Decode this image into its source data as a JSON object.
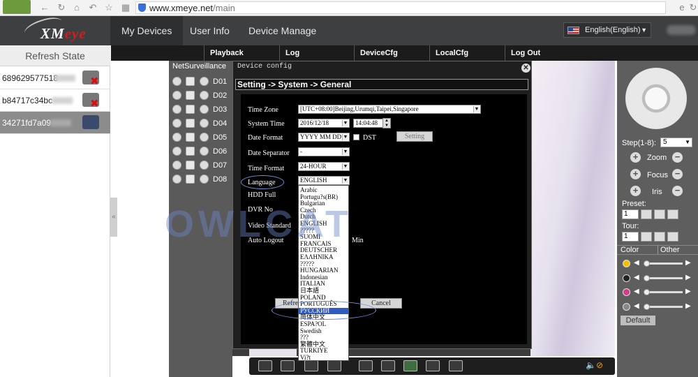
{
  "browser": {
    "url_host": "www.xmeye.net",
    "url_path": "/main"
  },
  "header": {
    "logo_prefix": "XM",
    "logo_suffix": "eye",
    "tabs": [
      "My Devices",
      "User Info",
      "Device Manage"
    ],
    "language": "English(English)"
  },
  "sidebar": {
    "refresh_label": "Refresh State",
    "devices": [
      "689629577518",
      "b84717c34bc",
      "34271fd7a09"
    ]
  },
  "toolbar": [
    "Playback",
    "Log",
    "DeviceCfg",
    "LocalCfg",
    "Log Out"
  ],
  "channels": {
    "title": "NetSurveillance",
    "items": [
      "D01",
      "D02",
      "D03",
      "D04",
      "D05",
      "D06",
      "D07",
      "D08"
    ]
  },
  "dialog": {
    "title": "Device config",
    "path": "Setting -> System -> General",
    "fields": {
      "time_zone_label": "Time Zone",
      "time_zone": "[UTC+08:00]Beijing,Urumqi,Taipei,Singapore",
      "system_time_label": "System Time",
      "date": "2016/12/18",
      "time": "14:04:48",
      "date_format_label": "Date Format",
      "date_format": "YYYY MM DD",
      "dst_label": "DST",
      "setting_button": "Setting",
      "date_separator_label": "Date Separator",
      "date_separator": "-",
      "time_format_label": "Time Format",
      "time_format": "24-HOUR",
      "language_label": "Language",
      "language": "ENGLISH",
      "hdd_full_label": "HDD Full",
      "dvr_no_label": "DVR No",
      "video_standard_label": "Video Standard",
      "auto_logout_label": "Auto Logout",
      "auto_logout_unit": "Min",
      "refresh_button": "Refresh",
      "cancel_button": "Cancel"
    },
    "language_options": [
      "Arabic",
      "Portugu?s(BR)",
      "Bulgarian",
      "Czech",
      "Dutch",
      "ENGLISH",
      "?????",
      "SUOMI",
      "FRANCAIS",
      "DEUTSCHER",
      "ΕΛΛΗΝΙΚΑ",
      "?????",
      "HUNGARIAN",
      "Indonesian",
      "ITALIAN",
      "日本語",
      "POLAND",
      "PORTUGUÊS",
      "РУССКИЙ",
      "简体中文",
      "ESPA?OL",
      "Swedish",
      "???",
      "繁體中文",
      "TURKIYE",
      "Vi?t"
    ],
    "selected_option": "РУССКИЙ"
  },
  "ptz": {
    "step_label": "Step(1-8):",
    "step_value": "5",
    "zoom": "Zoom",
    "focus": "Focus",
    "iris": "Iris",
    "preset_label": "Preset:",
    "preset_value": "1",
    "tour_label": "Tour:",
    "tour_value": "1",
    "color_tab": "Color",
    "other_tab": "Other",
    "default_button": "Default"
  },
  "watermark": "OWLCAT",
  "colors": {
    "header_bg": "#3d3f41",
    "toolbar_bg": "#1b1b1b",
    "highlight": "#2e5bbf",
    "logo_red": "#d41e1e"
  }
}
